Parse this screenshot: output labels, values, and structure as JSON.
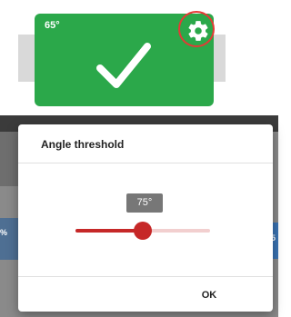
{
  "status_card": {
    "angle": "65°",
    "status_icon": "check-icon",
    "settings_icon": "gear-icon",
    "color": "#2ba84a",
    "highlight_color": "#e53935"
  },
  "background": {
    "left_text": "%",
    "right_text": "5"
  },
  "dialog": {
    "title": "Angle threshold",
    "slider": {
      "value_label": "75°",
      "fill_fraction": 0.5,
      "color": "#c62828"
    },
    "ok_label": "OK"
  }
}
